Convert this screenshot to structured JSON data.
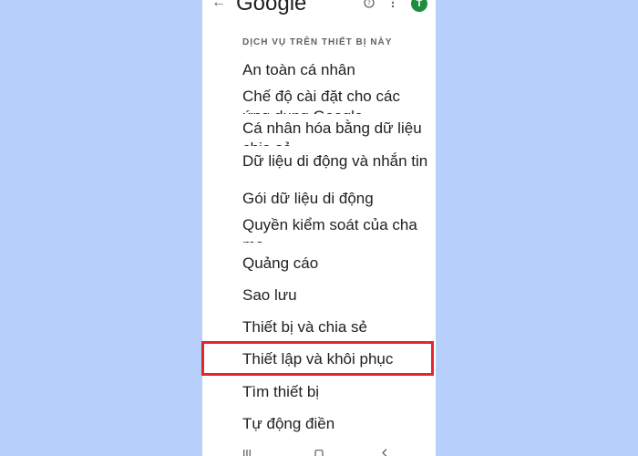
{
  "header": {
    "back_icon": "arrow-left-icon",
    "title": "Google",
    "help_icon": "help-circle-icon",
    "more_icon": "more-vertical-icon",
    "avatar_initial": "T",
    "avatar_color": "#1e8e3e"
  },
  "section": {
    "title": "DỊCH VỤ TRÊN THIẾT BỊ NÀY"
  },
  "items": [
    {
      "label": "An toàn cá nhân"
    },
    {
      "label": "Chế độ cài đặt cho các ứng dụng Google"
    },
    {
      "label": "Cá nhân hóa bằng dữ liệu chia sẻ"
    },
    {
      "label": "Dữ liệu di động và nhắn tin"
    },
    {
      "label": "Gói dữ liệu di động"
    },
    {
      "label": "Quyền kiểm soát của cha mẹ"
    },
    {
      "label": "Quảng cáo"
    },
    {
      "label": "Sao lưu"
    },
    {
      "label": "Thiết bị và chia sẻ"
    },
    {
      "label": "Thiết lập và khôi phục",
      "highlighted": true
    },
    {
      "label": "Tìm thiết bị"
    },
    {
      "label": "Tự động điền"
    }
  ],
  "colors": {
    "background": "#b6d0fb",
    "highlight_border": "#e3262b",
    "text": "#202124"
  }
}
